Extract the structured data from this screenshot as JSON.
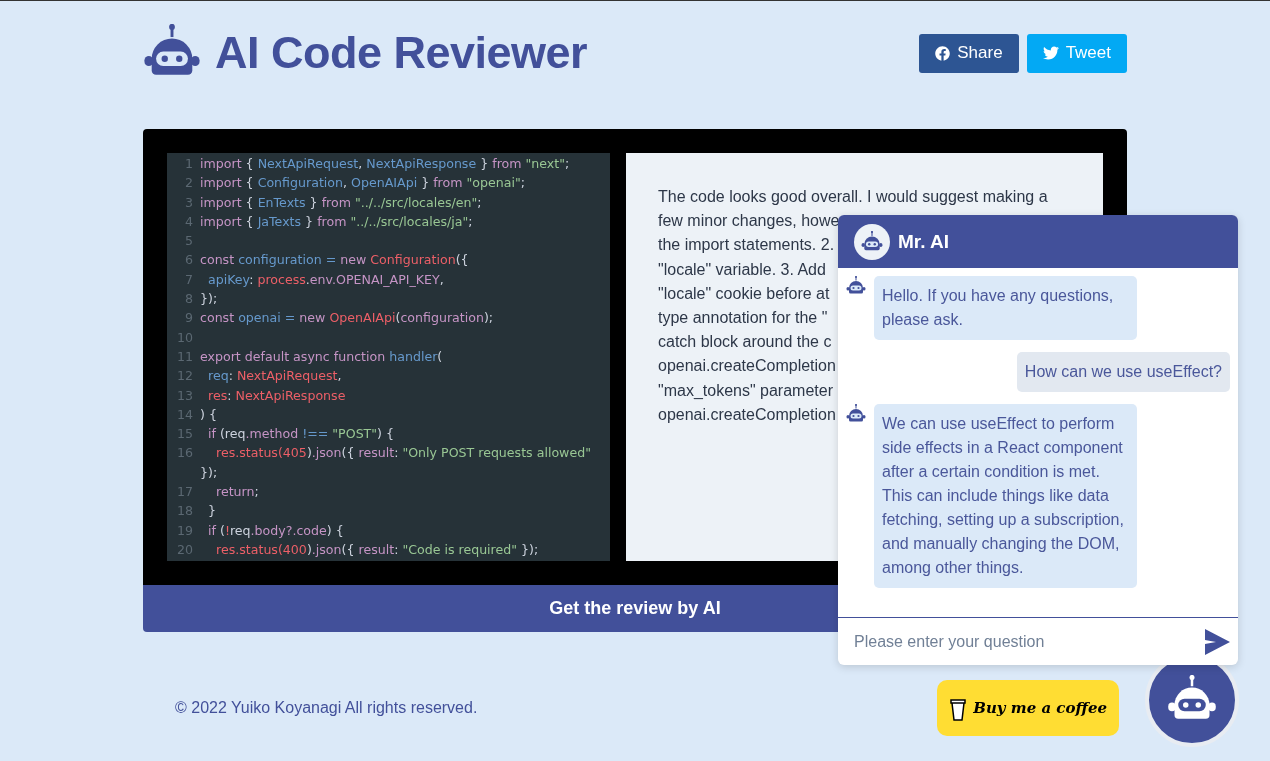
{
  "header": {
    "title": "AI Code Reviewer",
    "share_buttons": [
      {
        "kind": "facebook",
        "label": "Share"
      },
      {
        "kind": "twitter",
        "label": "Tweet"
      }
    ]
  },
  "code_editor": {
    "lines": [
      {
        "n": "1",
        "tokens": [
          {
            "kind": "keyword",
            "text": "import"
          },
          {
            "kind": "plain",
            "text": " { "
          },
          {
            "kind": "name",
            "text": "NextApiRequest"
          },
          {
            "kind": "plain",
            "text": ", "
          },
          {
            "kind": "name",
            "text": "NextApiResponse"
          },
          {
            "kind": "plain",
            "text": " } "
          },
          {
            "kind": "keyword",
            "text": "from"
          },
          {
            "kind": "string",
            "text": " \"next\""
          },
          {
            "kind": "plain",
            "text": ";"
          }
        ]
      },
      {
        "n": "2",
        "tokens": [
          {
            "kind": "keyword",
            "text": "import"
          },
          {
            "kind": "plain",
            "text": " { "
          },
          {
            "kind": "name",
            "text": "Configuration"
          },
          {
            "kind": "plain",
            "text": ", "
          },
          {
            "kind": "name",
            "text": "OpenAIApi"
          },
          {
            "kind": "plain",
            "text": " } "
          },
          {
            "kind": "keyword",
            "text": "from"
          },
          {
            "kind": "string",
            "text": " \"openai\""
          },
          {
            "kind": "plain",
            "text": ";"
          }
        ]
      },
      {
        "n": "3",
        "tokens": [
          {
            "kind": "keyword",
            "text": "import"
          },
          {
            "kind": "plain",
            "text": " { "
          },
          {
            "kind": "name",
            "text": "EnTexts"
          },
          {
            "kind": "plain",
            "text": " } "
          },
          {
            "kind": "keyword",
            "text": "from"
          },
          {
            "kind": "string",
            "text": " \"../../src/locales/en\""
          },
          {
            "kind": "plain",
            "text": ";"
          }
        ]
      },
      {
        "n": "4",
        "tokens": [
          {
            "kind": "keyword",
            "text": "import"
          },
          {
            "kind": "plain",
            "text": " { "
          },
          {
            "kind": "name",
            "text": "JaTexts"
          },
          {
            "kind": "plain",
            "text": " } "
          },
          {
            "kind": "keyword",
            "text": "from"
          },
          {
            "kind": "string",
            "text": " \"../../src/locales/ja\""
          },
          {
            "kind": "plain",
            "text": ";"
          }
        ]
      },
      {
        "n": "5"
      },
      {
        "n": "6",
        "tokens": [
          {
            "kind": "keyword",
            "text": "const"
          },
          {
            "kind": "name",
            "text": " configuration = "
          },
          {
            "kind": "keyword",
            "text": "new"
          },
          {
            "kind": "type",
            "text": " Configuration"
          },
          {
            "kind": "plain",
            "text": "({"
          }
        ]
      },
      {
        "n": "7",
        "tokens": [
          {
            "kind": "name",
            "text": "  apiKey"
          },
          {
            "kind": "plain",
            "text": ": "
          },
          {
            "kind": "type",
            "text": "process"
          },
          {
            "kind": "plain",
            "text": "."
          },
          {
            "kind": "keyword",
            "text": "env.OPENAI_API_KEY"
          },
          {
            "kind": "plain",
            "text": ","
          }
        ]
      },
      {
        "n": "8",
        "tokens": [
          {
            "kind": "plain",
            "text": "});"
          }
        ]
      },
      {
        "n": "9",
        "tokens": [
          {
            "kind": "keyword",
            "text": "const"
          },
          {
            "kind": "name",
            "text": " openai = "
          },
          {
            "kind": "keyword",
            "text": "new"
          },
          {
            "kind": "type",
            "text": " OpenAIApi"
          },
          {
            "kind": "plain",
            "text": "("
          },
          {
            "kind": "keyword",
            "text": "configuration"
          },
          {
            "kind": "plain",
            "text": ");"
          }
        ]
      },
      {
        "n": "10"
      },
      {
        "n": "11",
        "tokens": [
          {
            "kind": "keyword",
            "text": "export default async function"
          },
          {
            "kind": "name",
            "text": " handler"
          },
          {
            "kind": "plain",
            "text": "("
          }
        ]
      },
      {
        "n": "12",
        "tokens": [
          {
            "kind": "name",
            "text": "  req"
          },
          {
            "kind": "plain",
            "text": ": "
          },
          {
            "kind": "type",
            "text": "NextApiRequest"
          },
          {
            "kind": "plain",
            "text": ","
          }
        ]
      },
      {
        "n": "13",
        "tokens": [
          {
            "kind": "type",
            "text": "  res"
          },
          {
            "kind": "plain",
            "text": ": "
          },
          {
            "kind": "type",
            "text": "NextApiResponse"
          }
        ]
      },
      {
        "n": "14",
        "tokens": [
          {
            "kind": "plain",
            "text": ") {"
          }
        ]
      },
      {
        "n": "15",
        "tokens": [
          {
            "kind": "keyword",
            "text": "  if"
          },
          {
            "kind": "plain",
            "text": " (req"
          },
          {
            "kind": "keyword",
            "text": ".method"
          },
          {
            "kind": "name",
            "text": " !== "
          },
          {
            "kind": "string",
            "text": "\"POST\""
          },
          {
            "kind": "plain",
            "text": ") {"
          }
        ]
      },
      {
        "n": "16",
        "tokens": [
          {
            "kind": "type",
            "text": "    res.status(405"
          },
          {
            "kind": "plain",
            "text": ")"
          },
          {
            "kind": "keyword",
            "text": ".json"
          },
          {
            "kind": "plain",
            "text": "({ "
          },
          {
            "kind": "keyword",
            "text": "result"
          },
          {
            "kind": "plain",
            "text": ": "
          },
          {
            "kind": "string",
            "text": "\"Only POST requests allowed\""
          }
        ]
      },
      {
        "tokens": [
          {
            "kind": "plain",
            "text": "});"
          }
        ]
      },
      {
        "n": "17",
        "tokens": [
          {
            "kind": "keyword",
            "text": "    return"
          },
          {
            "kind": "plain",
            "text": ";"
          }
        ]
      },
      {
        "n": "18",
        "tokens": [
          {
            "kind": "plain",
            "text": "  }"
          }
        ]
      },
      {
        "n": "19",
        "tokens": [
          {
            "kind": "keyword",
            "text": "  if"
          },
          {
            "kind": "plain",
            "text": " ("
          },
          {
            "kind": "type",
            "text": "!"
          },
          {
            "kind": "plain",
            "text": "req"
          },
          {
            "kind": "keyword",
            "text": ".body?.code"
          },
          {
            "kind": "plain",
            "text": ") {"
          }
        ]
      },
      {
        "n": "20",
        "tokens": [
          {
            "kind": "type",
            "text": "    res.status(400"
          },
          {
            "kind": "plain",
            "text": ")"
          },
          {
            "kind": "keyword",
            "text": ".json"
          },
          {
            "kind": "plain",
            "text": "({ "
          },
          {
            "kind": "keyword",
            "text": "result"
          },
          {
            "kind": "plain",
            "text": ": "
          },
          {
            "kind": "string",
            "text": "\"Code is required\""
          },
          {
            "kind": "plain",
            "text": " });"
          }
        ]
      }
    ]
  },
  "review": {
    "lines": [
      "The code looks good overall. I would suggest making a",
      "few minor changes, howe",
      "the import statements. 2.",
      "\"locale\" variable. 3. Add",
      "\"locale\" cookie before at",
      "type annotation for the \"",
      "catch block around the c",
      "openai.createCompletion",
      "\"max_tokens\" parameter",
      "openai.createCompletion"
    ]
  },
  "review_button": "Get the review by AI",
  "footer": {
    "copyright": "© 2022 Yuiko Koyanagi All rights reserved.",
    "coffee_button": "Buy me a coffee"
  },
  "chat": {
    "title": "Mr. AI",
    "messages": [
      {
        "kind": "bot",
        "text": "Hello. If you have any questions, please ask."
      },
      {
        "kind": "user",
        "text": "How can we use useEffect?"
      },
      {
        "kind": "bot",
        "text": "We can use useEffect to perform side effects in a React component after a certain condition is met. This can include things like data fetching, setting up a subscription, and manually changing the DOM, among other things."
      }
    ],
    "input": {
      "placeholder": "Please enter your question"
    }
  }
}
